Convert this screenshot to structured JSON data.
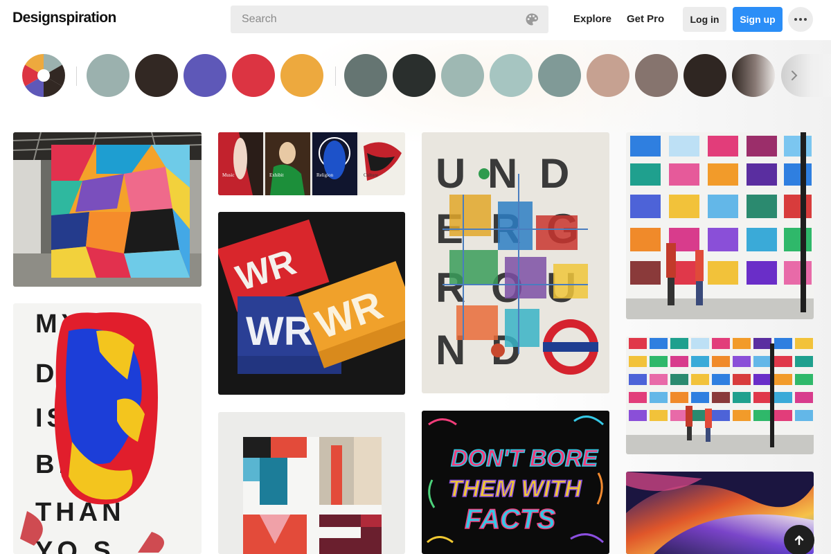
{
  "app": {
    "name": "Designspiration"
  },
  "search": {
    "placeholder": "Search",
    "value": "",
    "color_filter_icon": "palette-icon"
  },
  "nav": {
    "explore_label": "Explore",
    "getpro_label": "Get Pro"
  },
  "auth": {
    "login_label": "Log in",
    "signup_label": "Sign up"
  },
  "more_icon": "more-horizontal-icon",
  "colors": {
    "accent": "#2b8ef7",
    "primary_group": [
      "#9bb1ae",
      "#322823",
      "#5e58b8",
      "#dc3442",
      "#eda93e"
    ],
    "extended_group": [
      "#657572",
      "#2a2f2d",
      "#9eb8b3",
      "#a6c5c1",
      "#809a97",
      "#c6a191",
      "#86746e",
      "#2f2622"
    ]
  },
  "tiles": [
    {
      "name": "geometric-mural-image",
      "alt": "Colorful geometric mural"
    },
    {
      "name": "illustrated-posters-image",
      "alt": "Series of illustrated posters",
      "captions": [
        "Music",
        "Exhibit",
        "Religion",
        "Culture"
      ]
    },
    {
      "name": "wr-matchbooks-image",
      "alt": "WR logo matchbooks",
      "logo_text": [
        "WR",
        "WR",
        "WR"
      ]
    },
    {
      "name": "underground-poster-image",
      "alt": "Underground typographic poster",
      "letters": [
        "U",
        "N",
        "D",
        "E",
        "R",
        "G",
        "R",
        "O",
        "U",
        "N",
        "D"
      ]
    },
    {
      "name": "m-logo-wall-image",
      "alt": "Wall of M logos with pedestrians"
    },
    {
      "name": "m-logo-wall-wide-image",
      "alt": "Wall of M logos street view"
    },
    {
      "name": "brush-typography-poster-image",
      "alt": "Typographic poster with paint brushstroke",
      "lines": [
        "MY",
        "DA US",
        "IS",
        "BE R",
        "THAN",
        "YO S"
      ]
    },
    {
      "name": "time-typography-image",
      "alt": "Geometric TIME lettering"
    },
    {
      "name": "dont-bore-lettering-image",
      "alt": "Hand lettering poster",
      "lines": [
        "DON'T BORE",
        "THEM WITH",
        "FACTS"
      ]
    },
    {
      "name": "abstract-swirl-image",
      "alt": "Abstract colorful swirl"
    }
  ],
  "scroll_top_icon": "arrow-up-icon"
}
